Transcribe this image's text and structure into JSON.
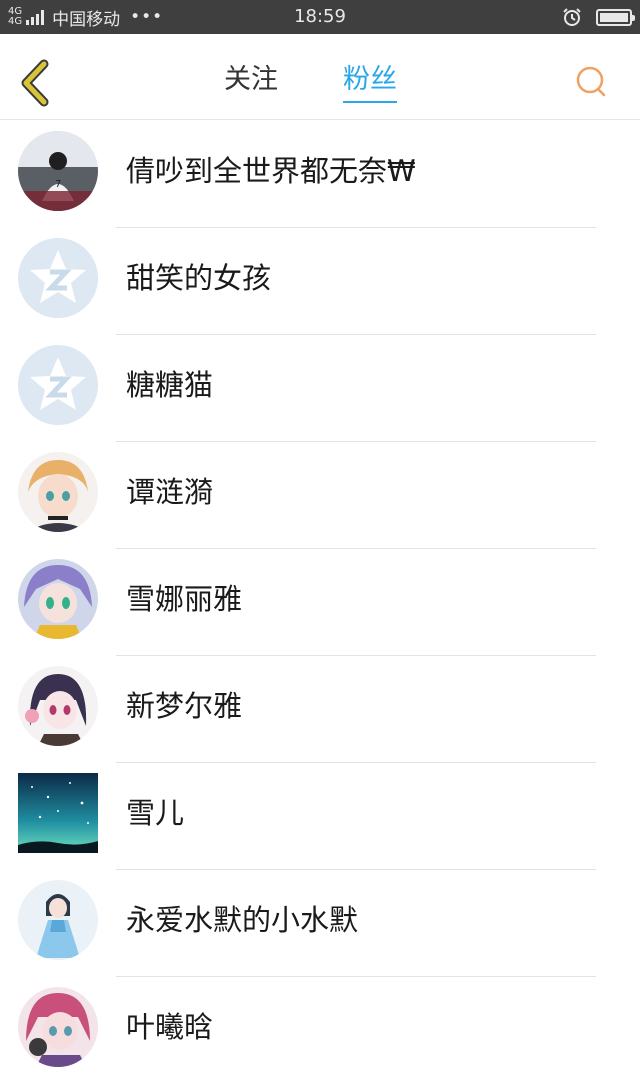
{
  "status_bar": {
    "network": "4G",
    "network2": "4G",
    "carrier": "中国移动",
    "dots": "•••",
    "time": "18:59"
  },
  "nav": {
    "tab_follow": "关注",
    "tab_fans": "粉丝",
    "active_tab": "粉丝",
    "accent_color": "#2aa7e8",
    "back_icon_color": "#d8c436",
    "search_icon_color": "#f0a060"
  },
  "fans": [
    {
      "name": "倩吵到全世界都无奈₩",
      "avatar": "photo-avatar"
    },
    {
      "name": "甜笑的女孩",
      "avatar": "default-qzone-avatar"
    },
    {
      "name": "糖糖猫",
      "avatar": "default-qzone-avatar"
    },
    {
      "name": "谭涟漪",
      "avatar": "anime-avatar"
    },
    {
      "name": "雪娜丽雅",
      "avatar": "anime-avatar"
    },
    {
      "name": "新梦尔雅",
      "avatar": "anime-avatar"
    },
    {
      "name": "雪儿",
      "avatar": "starry-sky-avatar"
    },
    {
      "name": "永爱水默的小水默",
      "avatar": "anime-avatar"
    },
    {
      "name": "叶曦晗",
      "avatar": "anime-avatar"
    }
  ]
}
